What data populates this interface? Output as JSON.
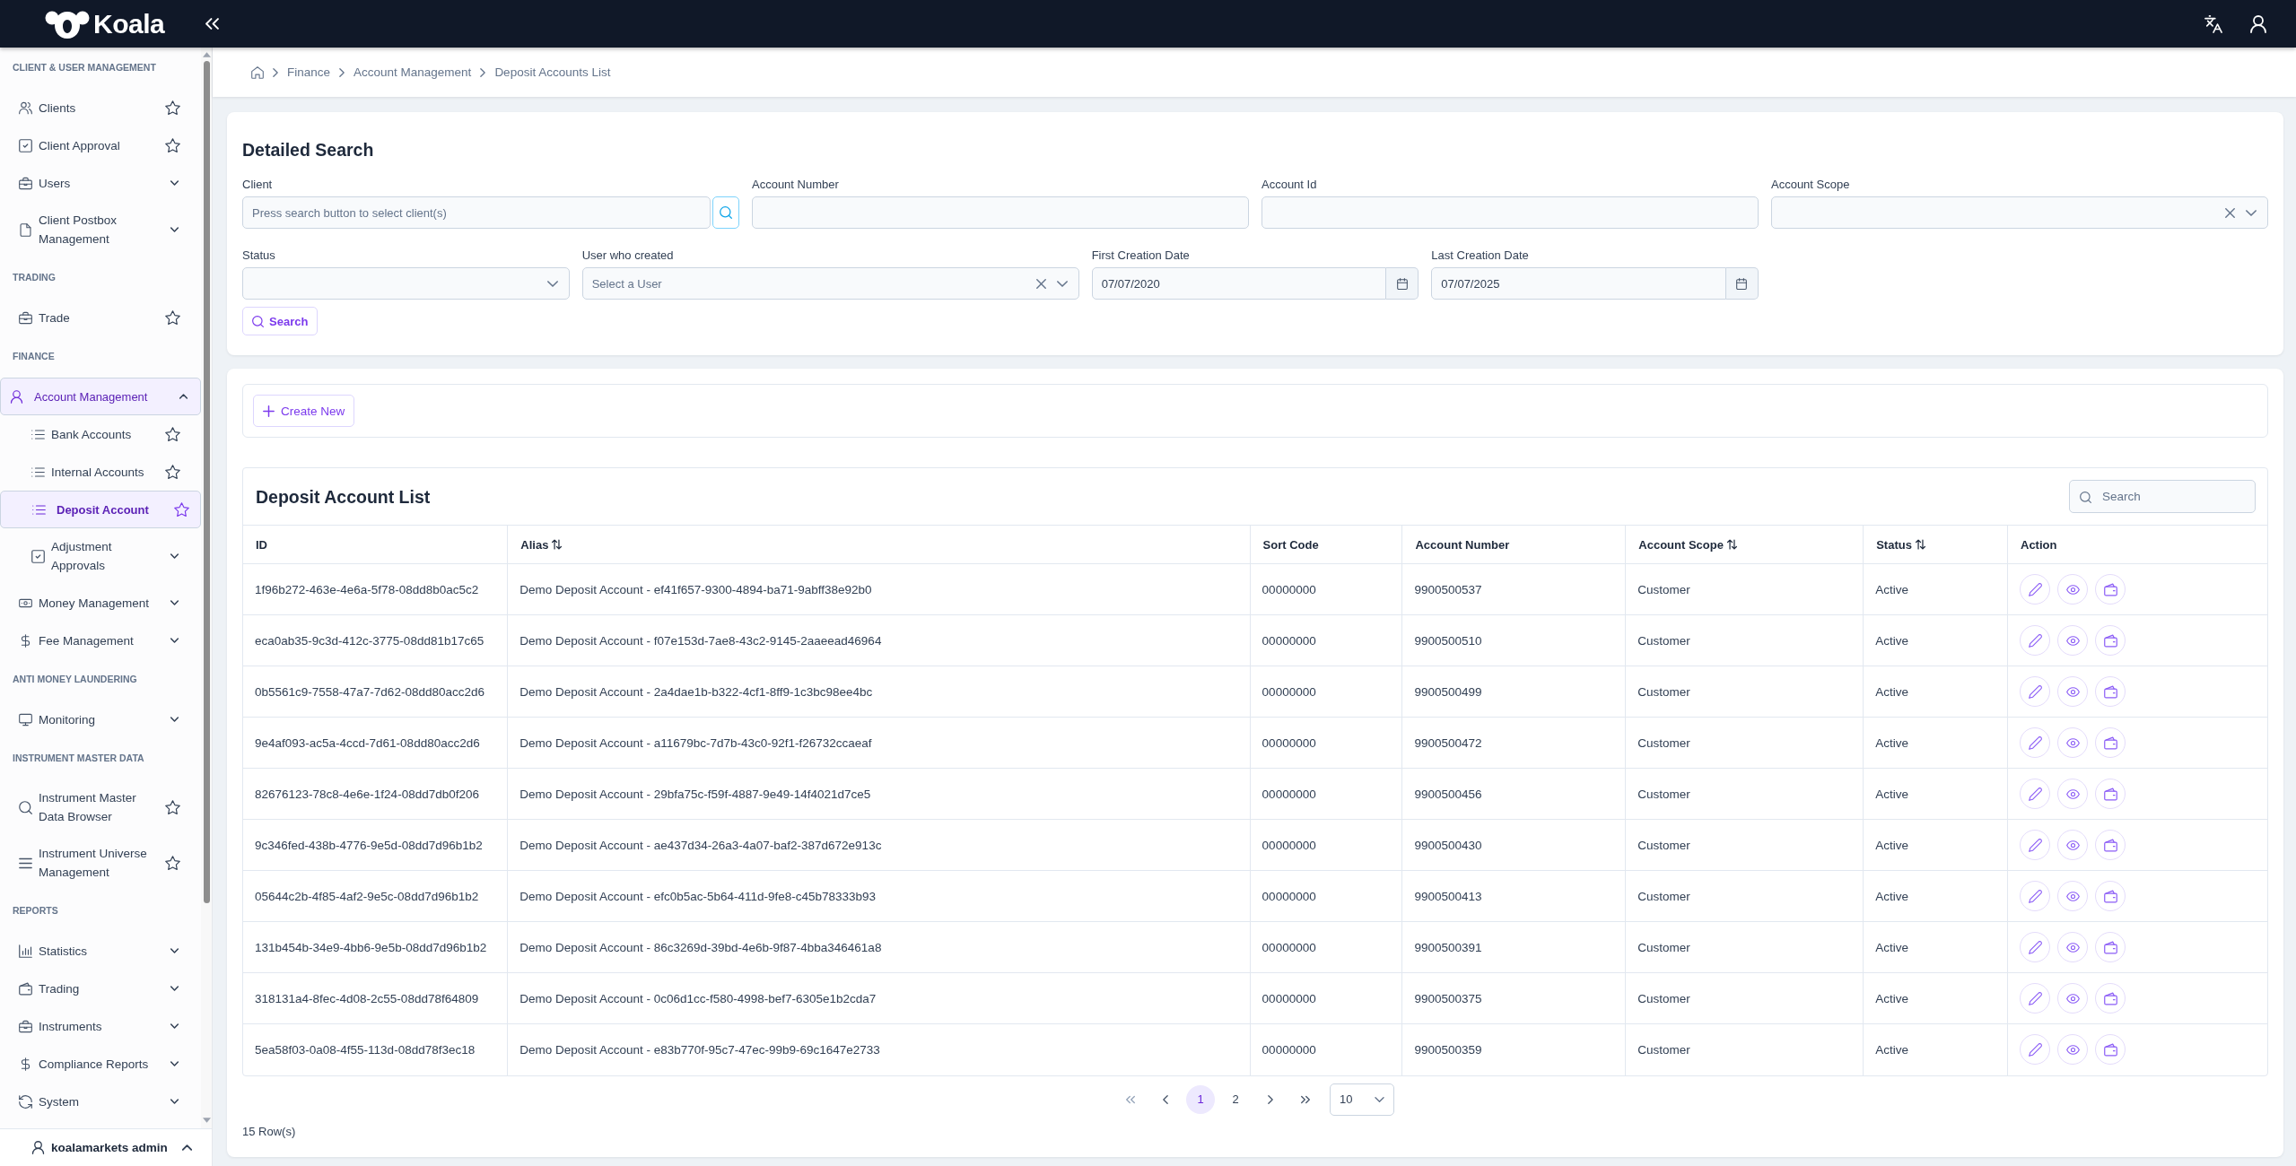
{
  "header": {
    "logo_text": "Koala"
  },
  "sidebar": {
    "sections": [
      {
        "title": "CLIENT & USER MANAGEMENT",
        "items": [
          {
            "label": "Clients",
            "kind": "link",
            "selected": false
          },
          {
            "label": "Client Approval",
            "kind": "link",
            "selected": false
          },
          {
            "label": "Users",
            "kind": "group",
            "expanded": false,
            "selected": false
          },
          {
            "label": "Client Postbox Management",
            "kind": "group",
            "expanded": false,
            "selected": false
          }
        ]
      },
      {
        "title": "TRADING",
        "items": [
          {
            "label": "Trade",
            "kind": "link",
            "selected": false
          }
        ]
      },
      {
        "title": "FINANCE",
        "items": [
          {
            "label": "Account Management",
            "kind": "group",
            "expanded": true,
            "selected": true,
            "children": [
              {
                "label": "Bank Accounts",
                "kind": "link",
                "selected": false
              },
              {
                "label": "Internal Accounts",
                "kind": "link",
                "selected": false
              },
              {
                "label": "Deposit Account",
                "kind": "link",
                "selected": true
              },
              {
                "label": "Adjustment Approvals",
                "kind": "group",
                "expanded": false,
                "selected": false
              }
            ]
          },
          {
            "label": "Money Management",
            "kind": "group",
            "expanded": false,
            "selected": false
          },
          {
            "label": "Fee Management",
            "kind": "group",
            "expanded": false,
            "selected": false
          }
        ]
      },
      {
        "title": "ANTI MONEY LAUNDERING",
        "items": [
          {
            "label": "Monitoring",
            "kind": "group",
            "expanded": false,
            "selected": false
          }
        ]
      },
      {
        "title": "INSTRUMENT MASTER DATA",
        "items": [
          {
            "label": "Instrument Master Data Browser",
            "kind": "link",
            "selected": false
          },
          {
            "label": "Instrument Universe Management",
            "kind": "link",
            "selected": false
          }
        ]
      },
      {
        "title": "REPORTS",
        "items": [
          {
            "label": "Statistics",
            "kind": "group",
            "expanded": false,
            "selected": false
          },
          {
            "label": "Trading",
            "kind": "group",
            "expanded": false,
            "selected": false
          },
          {
            "label": "Instruments",
            "kind": "group",
            "expanded": false,
            "selected": false
          },
          {
            "label": "Compliance Reports",
            "kind": "group",
            "expanded": false,
            "selected": false
          },
          {
            "label": "System",
            "kind": "group",
            "expanded": false,
            "selected": false
          }
        ]
      }
    ],
    "user": {
      "name": "koalamarkets admin"
    }
  },
  "breadcrumb": [
    "Finance",
    "Account Management",
    "Deposit Accounts List"
  ],
  "search_panel": {
    "title": "Detailed Search",
    "fields": [
      {
        "label": "Client",
        "kind": "lookup",
        "placeholder": "Press search button to select client(s)"
      },
      {
        "label": "Account Number",
        "kind": "text"
      },
      {
        "label": "Account Id",
        "kind": "text"
      },
      {
        "label": "Account Scope",
        "kind": "select",
        "clearable": true
      },
      {
        "label": "Status",
        "kind": "select",
        "clearable": false
      },
      {
        "label": "User who created",
        "kind": "select",
        "placeholder": "Select a User",
        "clearable": true
      },
      {
        "label": "First Creation Date",
        "kind": "date",
        "value": "07/07/2020"
      },
      {
        "label": "Last Creation Date",
        "kind": "date",
        "value": "07/07/2025"
      }
    ],
    "search_button": "Search"
  },
  "create_button": "Create New",
  "table": {
    "title": "Deposit Account List",
    "search": {
      "placeholder": "Search"
    },
    "columns": [
      {
        "label": "ID",
        "sortable": false
      },
      {
        "label": "Alias",
        "sortable": true
      },
      {
        "label": "Sort Code",
        "sortable": false
      },
      {
        "label": "Account Number",
        "sortable": false
      },
      {
        "label": "Account Scope",
        "sortable": true
      },
      {
        "label": "Status",
        "sortable": true
      },
      {
        "label": "Action",
        "sortable": false
      }
    ],
    "rows": [
      [
        "1f96b272-463e-4e6a-5f78-08dd8b0ac5c2",
        "Demo Deposit Account - ef41f657-9300-4894-ba71-9abff38e92b0",
        "00000000",
        "9900500537",
        "Customer",
        "Active"
      ],
      [
        "eca0ab35-9c3d-412c-3775-08dd81b17c65",
        "Demo Deposit Account - f07e153d-7ae8-43c2-9145-2aaeead46964",
        "00000000",
        "9900500510",
        "Customer",
        "Active"
      ],
      [
        "0b5561c9-7558-47a7-7d62-08dd80acc2d6",
        "Demo Deposit Account - 2a4dae1b-b322-4cf1-8ff9-1c3bc98ee4bc",
        "00000000",
        "9900500499",
        "Customer",
        "Active"
      ],
      [
        "9e4af093-ac5a-4ccd-7d61-08dd80acc2d6",
        "Demo Deposit Account - a11679bc-7d7b-43c0-92f1-f26732ccaeaf",
        "00000000",
        "9900500472",
        "Customer",
        "Active"
      ],
      [
        "82676123-78c8-4e6e-1f24-08dd7db0f206",
        "Demo Deposit Account - 29bfa75c-f59f-4887-9e49-14f4021d7ce5",
        "00000000",
        "9900500456",
        "Customer",
        "Active"
      ],
      [
        "9c346fed-438b-4776-9e5d-08dd7d96b1b2",
        "Demo Deposit Account - ae437d34-26a3-4a07-baf2-387d672e913c",
        "00000000",
        "9900500430",
        "Customer",
        "Active"
      ],
      [
        "05644c2b-4f85-4af2-9e5c-08dd7d96b1b2",
        "Demo Deposit Account - efc0b5ac-5b64-411d-9fe8-c45b78333b93",
        "00000000",
        "9900500413",
        "Customer",
        "Active"
      ],
      [
        "131b454b-34e9-4bb6-9e5b-08dd7d96b1b2",
        "Demo Deposit Account - 86c3269d-39bd-4e6b-9f87-4bba346461a8",
        "00000000",
        "9900500391",
        "Customer",
        "Active"
      ],
      [
        "318131a4-8fec-4d08-2c55-08dd78f64809",
        "Demo Deposit Account - 0c06d1cc-f580-4998-bef7-6305e1b2cda7",
        "00000000",
        "9900500375",
        "Customer",
        "Active"
      ],
      [
        "5ea58f03-0a08-4f55-113d-08dd78f3ec18",
        "Demo Deposit Account - e83b770f-95c7-47ec-99b9-69c1647e2733",
        "00000000",
        "9900500359",
        "Customer",
        "Active"
      ]
    ]
  },
  "pagination": {
    "pages": [
      {
        "label": "1",
        "selected": true
      },
      {
        "label": "2",
        "selected": false
      }
    ],
    "page_size": "10",
    "row_count": "15 Row(s)"
  }
}
